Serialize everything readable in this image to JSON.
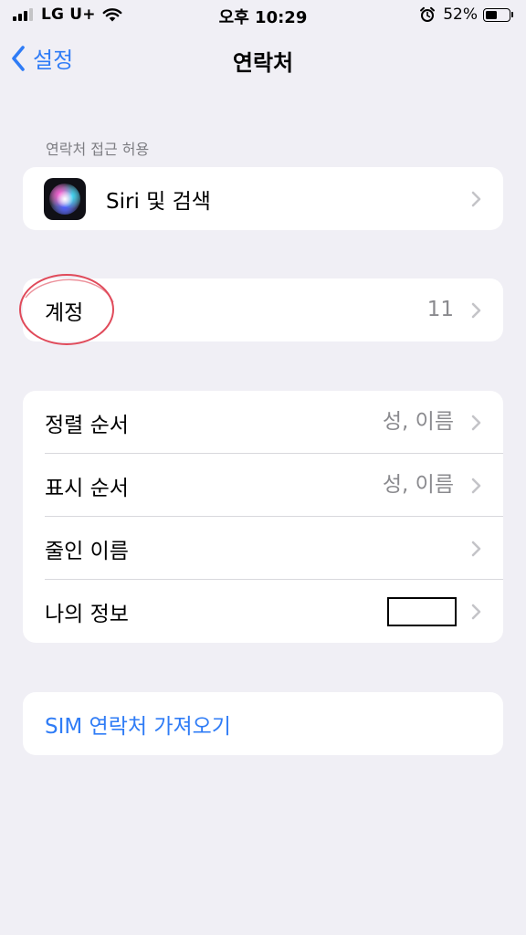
{
  "status_bar": {
    "carrier": "LG U+",
    "time": "오후 10:29",
    "battery_percent": "52%",
    "battery_level": 0.52,
    "icons": [
      "signal-icon",
      "wifi-icon",
      "alarm-icon",
      "battery-icon"
    ]
  },
  "nav": {
    "back_label": "설정",
    "title": "연락처"
  },
  "section_header": "연락처 접근 허용",
  "siri_row": {
    "label": "Siri 및 검색",
    "icon": "siri-icon"
  },
  "accounts_row": {
    "label": "계정",
    "value": "11"
  },
  "settings_rows": [
    {
      "label": "정렬 순서",
      "value": "성, 이름"
    },
    {
      "label": "표시 순서",
      "value": "성, 이름"
    },
    {
      "label": "줄인 이름",
      "value": ""
    },
    {
      "label": "나의 정보",
      "value": ""
    }
  ],
  "import_sim": {
    "label": "SIM 연락처 가져오기"
  },
  "colors": {
    "background": "#f0eff5",
    "accent": "#2f7cf6",
    "secondary_text": "#8a8a8e",
    "annotation": "#e04a5a"
  }
}
